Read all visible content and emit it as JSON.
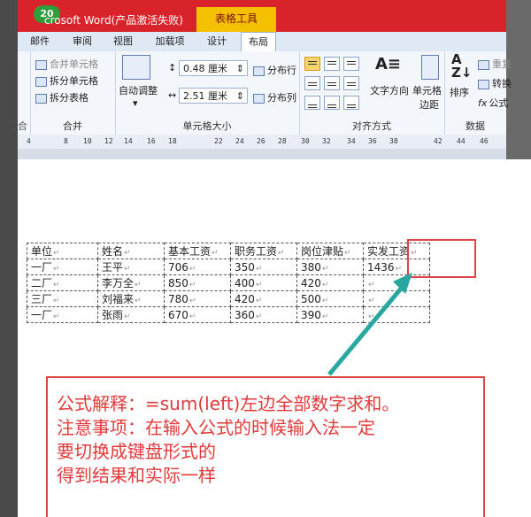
{
  "window": {
    "badge": "20",
    "title": "crosoft Word(产品激活失败)",
    "context_tab_group": "表格工具"
  },
  "tabs": [
    "邮件",
    "审阅",
    "视图",
    "加载项",
    "设计",
    "布局"
  ],
  "active_tab": "布局",
  "ribbon": {
    "merge_group": {
      "items": [
        "合并单元格",
        "拆分单元格",
        "拆分表格"
      ],
      "label": "合并"
    },
    "cell_size_group": {
      "autofit_label": "自动调整",
      "height_value": "0.48 厘米",
      "width_value": "2.51 厘米",
      "distribute_rows": "分布行",
      "distribute_cols": "分布列",
      "label": "单元格大小"
    },
    "alignment_group": {
      "text_direction": "文字方向",
      "cell_margins_line1": "单元格",
      "cell_margins_line2": "边距",
      "label": "对齐方式"
    },
    "data_group": {
      "sort": "排序",
      "repeat_header": "重复",
      "convert": "转换",
      "formula": "公式",
      "label": "数据"
    },
    "left_cut_label": "合"
  },
  "ruler_ticks": [
    "4",
    "8",
    "10",
    "12",
    "14",
    "16",
    "18",
    "22",
    "24",
    "26",
    "28",
    "30",
    "32",
    "34",
    "36",
    "38",
    "42",
    "44",
    "46"
  ],
  "table": {
    "headers": [
      "单位",
      "姓名",
      "基本工资",
      "职务工资",
      "岗位津贴",
      "实发工资"
    ],
    "rows": [
      [
        "一厂",
        "王平",
        "706",
        "350",
        "380",
        "1436"
      ],
      [
        "二厂",
        "李万全",
        "850",
        "400",
        "420",
        ""
      ],
      [
        "三厂",
        "刘福来",
        "780",
        "420",
        "500",
        ""
      ],
      [
        "一厂",
        "张雨",
        "670",
        "360",
        "390",
        ""
      ]
    ],
    "paragraph_mark": "↵"
  },
  "note": {
    "line1": "公式解释：=sum(left)左边全部数字求和。",
    "line2": "注意事项：在输入公式的时候输入法一定",
    "line3": "要切换成键盘形式的",
    "line4": "得到结果和实际一样"
  },
  "colors": {
    "title_bar": "#d9232a",
    "context_tab": "#f4c000",
    "annotation_red": "#e04545",
    "arrow_teal": "#2aa7a0"
  }
}
